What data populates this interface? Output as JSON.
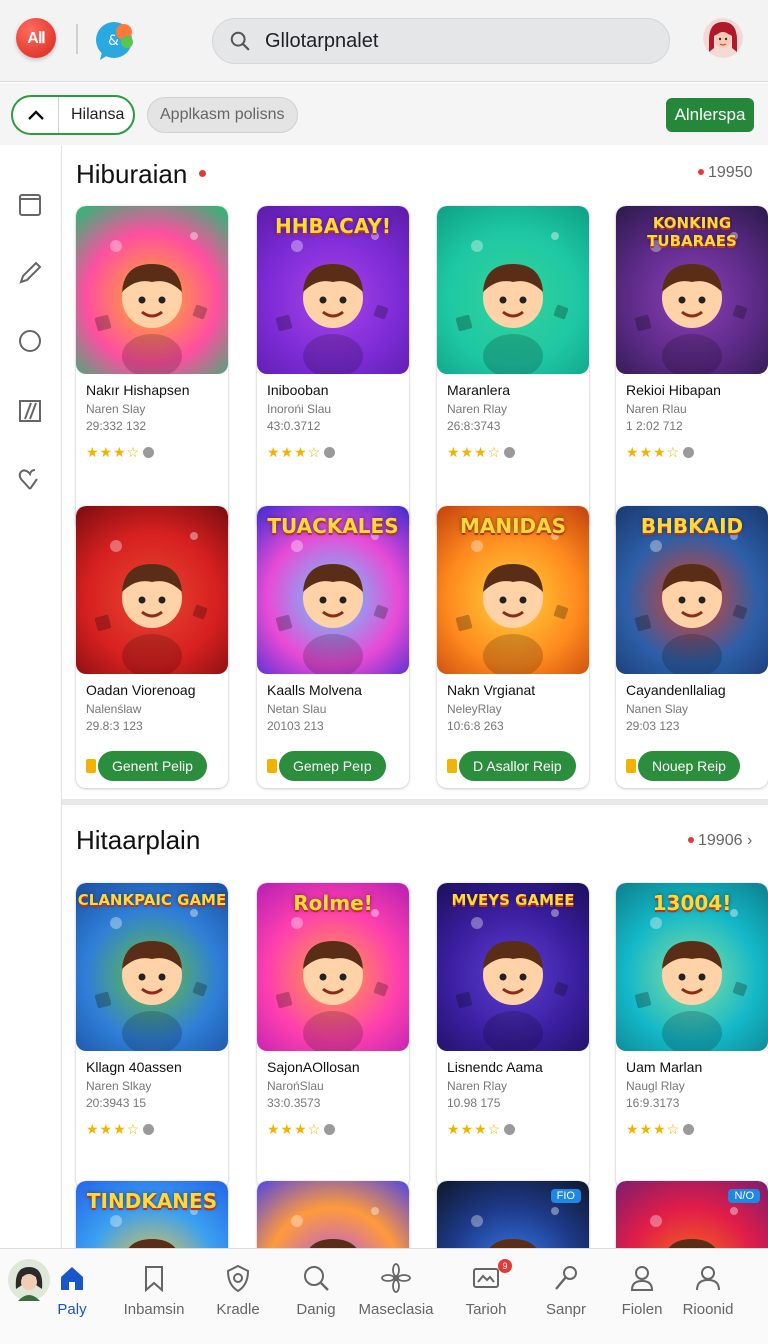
{
  "topbar": {
    "logo_text": "AⅡ",
    "search_value": "Gllotarpnalet",
    "search_placeholder": "Gllotarpnalet"
  },
  "filters": {
    "chip_main_label": "Hilansa",
    "chip_secondary_label": "Applkasm polisns",
    "action_button_label": "Alnlerspa"
  },
  "sections": [
    {
      "title": "Hiburaian",
      "count": "19950",
      "cards": [
        {
          "title": "Nakır Hishapsen",
          "subtitle": "Naren Slay",
          "meta": "29:332 132",
          "stars": "★★★☆",
          "colors": [
            "#ff4fa0",
            "#ffb21e",
            "#1dbf73"
          ]
        },
        {
          "title": "Inibooban",
          "subtitle": "Inorońi Slau",
          "meta": "43:0.3712",
          "stars": "★★★☆",
          "colors": [
            "#7d2bd6",
            "#a845e8",
            "#5a1ca8"
          ],
          "art_text": "HHBACAY!"
        },
        {
          "title": "Maranlera",
          "subtitle": "Naren Rlay",
          "meta": "26:8:3743",
          "stars": "★★★☆",
          "colors": [
            "#1ec8a4",
            "#34d399",
            "#0e9f85"
          ]
        },
        {
          "title": "Rekioi Hibapan",
          "subtitle": "Naren Rlau",
          "meta": "1 2:02 712",
          "stars": "★★★☆",
          "colors": [
            "#5b2a86",
            "#8e3fb8",
            "#2c1a4a"
          ],
          "art_text": "KONKING TUBARAES"
        }
      ]
    },
    {
      "title": "",
      "count": "",
      "cards": [
        {
          "title": "Oadan Viorenoag",
          "subtitle": "Nalenślaw",
          "meta": "29.8:3 123",
          "play": "Genent Pelip",
          "colors": [
            "#d62020",
            "#e84830",
            "#7a0c10"
          ]
        },
        {
          "title": "Kaalls Molvena",
          "subtitle": "Netan Slau",
          "meta": "20103 213",
          "play": "Gemep Peıp",
          "colors": [
            "#e84bd6",
            "#5fd0ff",
            "#3b2ad1"
          ],
          "art_text": "TUACKALES"
        },
        {
          "title": "Nakn Vrgianat",
          "subtitle": "NeleyRlay",
          "meta": "10:6:8 263",
          "play": "D Asallor Reip",
          "colors": [
            "#ff8a1e",
            "#ffd23b",
            "#c2410c"
          ],
          "art_text": "MANIDAS"
        },
        {
          "title": "Cayandenllaliag",
          "subtitle": "Nanen Slay",
          "meta": "29:03 123",
          "play": "Nouep Reip",
          "colors": [
            "#2d5fa8",
            "#e0402a",
            "#1a3870"
          ],
          "art_text": "BHBKAID"
        }
      ]
    },
    {
      "title": "Hitaarplain",
      "count": "19906",
      "cards": [
        {
          "title": "Kllagn 40assen",
          "subtitle": "Naren Slkay",
          "meta": "20:3943 15",
          "stars": "★★★☆",
          "colors": [
            "#2f7fd8",
            "#67c23a",
            "#1a4fa0"
          ],
          "art_text": "CLANKPAIC GAME"
        },
        {
          "title": "SajonAOllosan",
          "subtitle": "NarońSlau",
          "meta": "33:0.3573",
          "stars": "★★★☆",
          "colors": [
            "#ff3fae",
            "#ffa13f",
            "#b51fb5"
          ],
          "art_text": "Rolme!"
        },
        {
          "title": "Lisnendc Aama",
          "subtitle": "Naren Rlay",
          "meta": "10.98 175",
          "stars": "★★★☆",
          "colors": [
            "#3a1e9e",
            "#5d3fd3",
            "#1c0f5c"
          ],
          "art_text": "MVEYS GAMEE"
        },
        {
          "title": "Uam Marlan",
          "subtitle": "Naugl Rlay",
          "meta": "16:9.3173",
          "stars": "★★★☆",
          "colors": [
            "#14b8c8",
            "#88e0a0",
            "#0d7f8c"
          ],
          "art_text": "13004!"
        }
      ]
    },
    {
      "title": "",
      "count": "",
      "cards": [
        {
          "colors": [
            "#3aa0f0",
            "#ffcc33",
            "#2563eb"
          ],
          "art_text": "TINDKANES"
        },
        {
          "colors": [
            "#ff9a3c",
            "#a855f7",
            "#4f46e5"
          ]
        },
        {
          "colors": [
            "#1e3a8a",
            "#3b82f6",
            "#0f172a"
          ],
          "badge": "FIO"
        },
        {
          "colors": [
            "#e11d48",
            "#f97316",
            "#7c1d6f"
          ],
          "badge": "N/O"
        }
      ]
    }
  ],
  "bottom_nav": [
    {
      "label": "Paly",
      "icon": "home-icon",
      "active": true
    },
    {
      "label": "Inbamsin",
      "icon": "bookmark-icon"
    },
    {
      "label": "Kradle",
      "icon": "shield-icon"
    },
    {
      "label": "Danig",
      "icon": "search-icon"
    },
    {
      "label": "Maseclasia",
      "icon": "flower-icon"
    },
    {
      "label": "Tarioh",
      "icon": "inbox-icon",
      "badge": "9"
    },
    {
      "label": "Sanpr",
      "icon": "microphone-icon"
    },
    {
      "label": "Fiolen",
      "icon": "person-icon"
    },
    {
      "label": "Rioonid",
      "icon": "profile-icon"
    }
  ],
  "colors": {
    "accent_green": "#2b8e3d",
    "nav_active": "#1a56c8",
    "dot_red": "#e53935"
  }
}
